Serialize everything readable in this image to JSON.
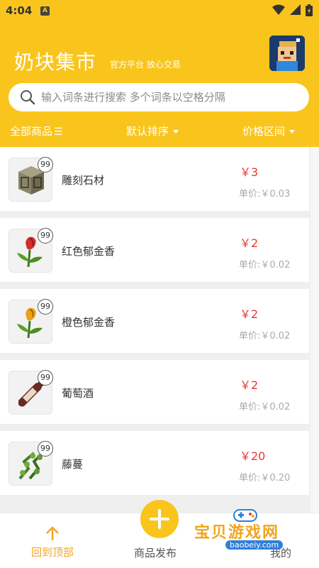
{
  "status_bar": {
    "time": "4:04",
    "notif_letter": "A"
  },
  "header": {
    "title": "奶块集市",
    "subtitle": "官方平台 放心交易",
    "avatar_icon": "game-character-avatar"
  },
  "search": {
    "placeholder": "输入词条进行搜索 多个词条以空格分隔"
  },
  "filters": {
    "all_label": "全部商品",
    "all_glyph": "☰",
    "sort_label": "默认排序",
    "price_label": "价格区间"
  },
  "items": [
    {
      "name": "雕刻石材",
      "qty": "99",
      "price": "￥3",
      "unit_price": "单价:￥0.03",
      "icon": "carved-stone-icon"
    },
    {
      "name": "红色郁金香",
      "qty": "99",
      "price": "￥2",
      "unit_price": "单价:￥0.02",
      "icon": "red-tulip-icon"
    },
    {
      "name": "橙色郁金香",
      "qty": "99",
      "price": "￥2",
      "unit_price": "单价:￥0.02",
      "icon": "orange-tulip-icon"
    },
    {
      "name": "葡萄酒",
      "qty": "99",
      "price": "￥2",
      "unit_price": "单价:￥0.02",
      "icon": "wine-bottle-icon"
    },
    {
      "name": "藤蔓",
      "qty": "99",
      "price": "￥20",
      "unit_price": "单价:￥0.20",
      "icon": "vine-icon"
    }
  ],
  "bottom_nav": {
    "top_label": "回到顶部",
    "publish_label": "商品发布",
    "mine_label": "我的"
  },
  "watermark": {
    "main": "宝贝游戏网",
    "sub": "baobeiy.com"
  },
  "colors": {
    "brand": "#f9c51d",
    "price": "#e53935",
    "accent": "#f5a623"
  }
}
